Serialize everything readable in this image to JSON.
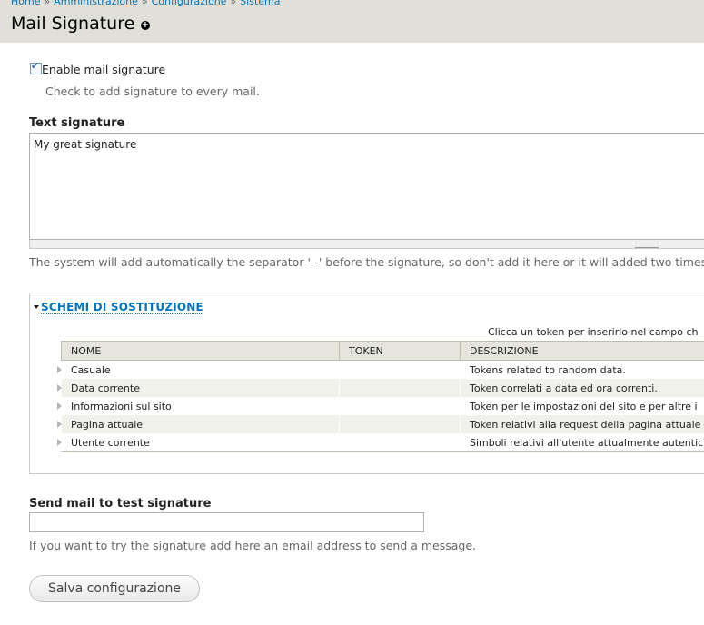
{
  "breadcrumb": [
    "Home",
    "Amministrazione",
    "Configurazione",
    "Sistema"
  ],
  "breadcrumb_separator": "»",
  "page_title": "Mail Signature",
  "shortcut_icon": "plus-circle-icon",
  "enable_signature": {
    "label": "Enable mail signature",
    "checked": true,
    "description": "Check to add signature to every mail."
  },
  "text_signature": {
    "label": "Text signature",
    "value": "My great signature",
    "description": "The system will add automatically the separator '--' before the signature, so don't add it here or it will added two times."
  },
  "replacement_patterns": {
    "legend": "SCHEMI DI SOSTITUZIONE",
    "hint": "Clicca un token per inserirlo nel campo ch",
    "columns": [
      "NOME",
      "TOKEN",
      "DESCRIZIONE"
    ],
    "rows": [
      {
        "name": "Casuale",
        "token": "",
        "description": "Tokens related to random data."
      },
      {
        "name": "Data corrente",
        "token": "",
        "description": "Token correlati a data ed ora correnti."
      },
      {
        "name": "Informazioni sul sito",
        "token": "",
        "description": "Token per le impostazioni del sito e per altre i"
      },
      {
        "name": "Pagina attuale",
        "token": "",
        "description": "Token relativi alla request della pagina attuale"
      },
      {
        "name": "Utente corrente",
        "token": "",
        "description": "Simboli relativi all'utente attualmente autentic"
      }
    ]
  },
  "test_mail": {
    "label": "Send mail to test signature",
    "value": "",
    "description": "If you want to try the signature add here an email address to send a message."
  },
  "save_button": "Salva configurazione"
}
